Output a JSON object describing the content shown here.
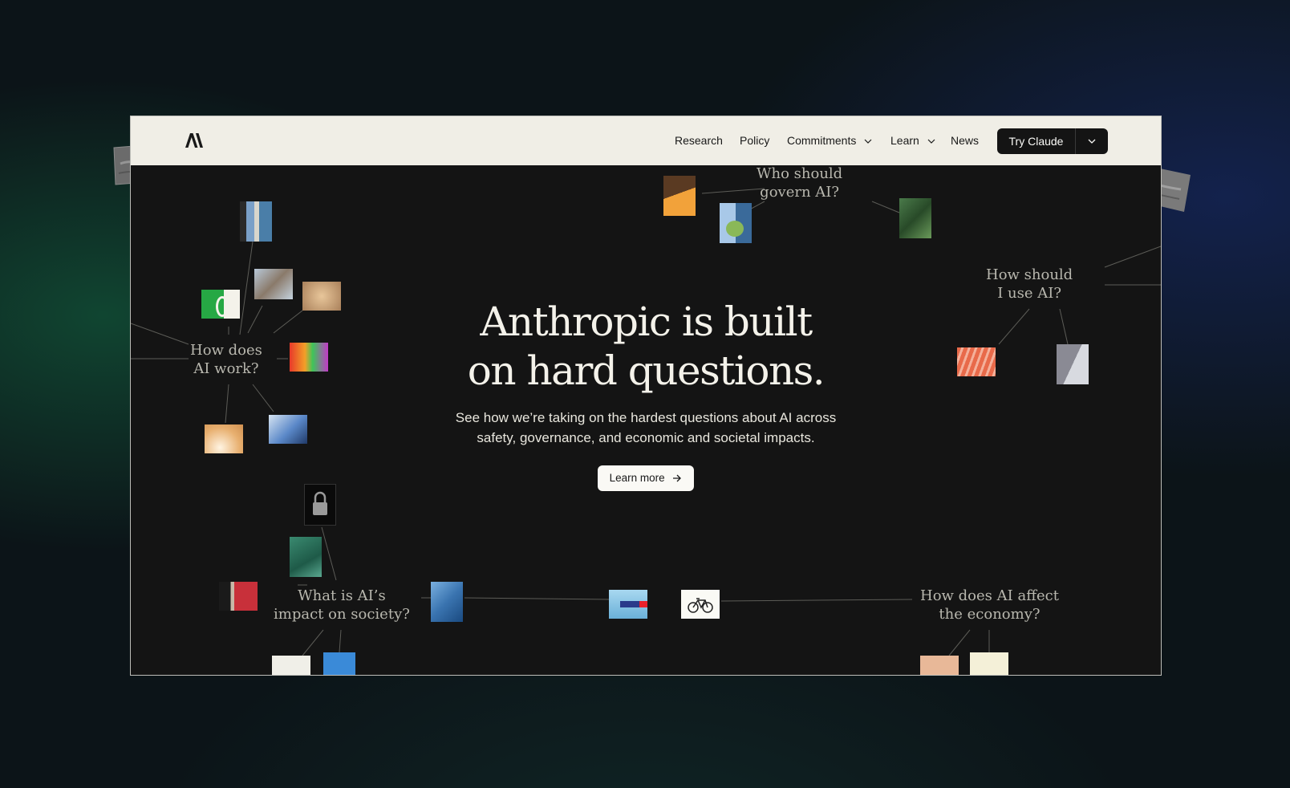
{
  "nav": {
    "logo_alt": "Anthropic",
    "items": [
      {
        "label": "Research",
        "has_menu": false
      },
      {
        "label": "Policy",
        "has_menu": false
      },
      {
        "label": "Commitments",
        "has_menu": true
      },
      {
        "label": "Learn",
        "has_menu": true
      },
      {
        "label": "News",
        "has_menu": false
      }
    ],
    "cta_label": "Try Claude"
  },
  "hero": {
    "title_line1": "Anthropic is built",
    "title_line2": "on hard questions.",
    "subtitle_line1": "See how we’re taking on the hardest questions about AI across",
    "subtitle_line2": "safety, governance, and economic and societal impacts.",
    "button_label": "Learn more"
  },
  "questions": {
    "govern": {
      "line1": "Who should",
      "line2": "govern AI?"
    },
    "use": {
      "line1": "How should",
      "line2": "I use AI?"
    },
    "work": {
      "line1": "How does",
      "line2": "AI work?"
    },
    "society": {
      "line1": "What is AI’s",
      "line2": "impact on society?"
    },
    "economy": {
      "line1": "How does AI affect",
      "line2": "the economy?"
    }
  },
  "colors": {
    "page_background": "#0c1418",
    "hero_background": "#141414",
    "nav_background": "#f0eee6",
    "cta_background": "#141414",
    "question_text": "#b8b7ae",
    "hero_text": "#f4f2ea"
  },
  "icons": [
    "anthropic-logo",
    "chevron-down-icon",
    "arrow-right-icon",
    "bicycle-icon",
    "padlock-icon"
  ]
}
